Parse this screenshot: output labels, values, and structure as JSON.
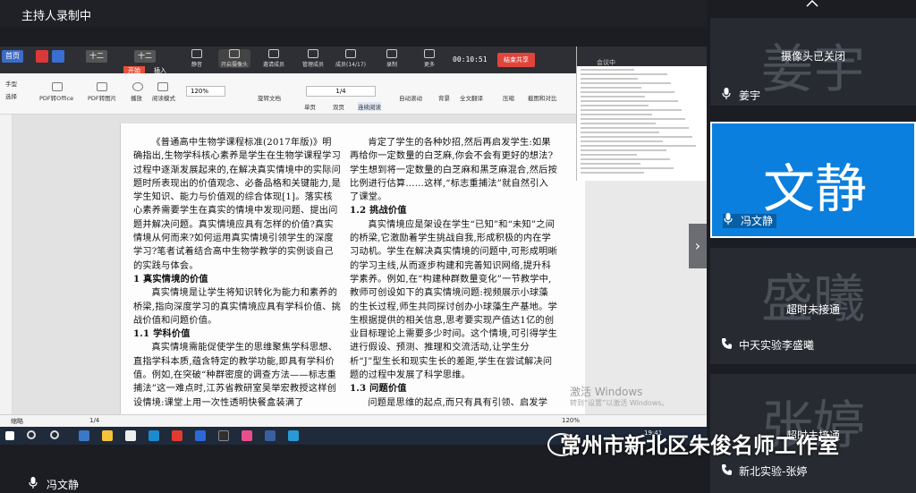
{
  "recording": {
    "label": "主持人录制中"
  },
  "share_toolbar": {
    "tabs": [
      "首页",
      "",
      "",
      "",
      "十二",
      "十二"
    ],
    "items": [
      "静音",
      "开启摄像头",
      "邀请成员",
      "管理成员",
      "成员(14/17)",
      "录制",
      "更多"
    ],
    "timer": "00:10:51",
    "end_label": "结束共享",
    "start_tab": "开始",
    "insert_tab": "插入"
  },
  "ribbon": {
    "items": [
      "手型",
      "选择",
      "PDF转Office",
      "PDF转图片",
      "播放",
      "阅读模式",
      "旋转文档",
      "单页",
      "双页",
      "连续阅读",
      "自动滚动",
      "背景",
      "全文翻译",
      "压缩",
      "截图和对比"
    ],
    "zoom": "120%",
    "page": "1/4"
  },
  "document": {
    "col1": [
      {
        "t": "《普通高中生物学课程标准(2017年版)》明确指出,生物学科核心素养是学生在生物学课程学习过程中逐渐发展起来的,在解决真实情境中的实际问题时所表现出的价值观念、必备品格和关键能力,是学生知识、能力与价值观的综合体现[1]。落实核心素养需要学生在真实的情境中发现问题、提出问题并解决问题。真实情境应具有怎样的价值?真实情境从何而来?如何运用真实情境引领学生的深度学习?笔者试着结合高中生物学教学的实例谈自己的实践与体会。",
        "h": false
      },
      {
        "t": "1 真实情境的价值",
        "h": true
      },
      {
        "t": "真实情境是让学生将知识转化为能力和素养的桥梁,指向深度学习的真实情境应具有学科价值、挑战价值和问题价值。",
        "h": false
      },
      {
        "t": "1.1 学科价值",
        "h": true
      },
      {
        "t": "真实情境需能促使学生的思维聚焦学科思想、直指学科本质,蕴含特定的教学功能,即具有学科价值。例如,在突破“种群密度的调查方法——标志重捕法”这一难点时,江苏省教研室吴举宏教授这样创设情境:课堂上用一次性透明快餐盒装满了",
        "h": false
      }
    ],
    "col2": [
      {
        "t": "肯定了学生的各种妙招,然后再启发学生:如果再给你一定数量的白芝麻,你会不会有更好的想法?学生想到将一定数量的白芝麻和黑芝麻混合,然后按比例进行估算……这样,“标志重捕法”就自然引入了课堂。",
        "h": false
      },
      {
        "t": "1.2 挑战价值",
        "h": true
      },
      {
        "t": "真实情境应是架设在学生“已知”和“未知”之间的桥梁,它激励着学生挑战自我,形成积极的内在学习动机。学生在解决真实情境的问题中,可形成明晰的学习主线,从而逐步构建和完善知识网络,提升科学素养。例如,在“构建种群数量变化”一节教学中,教师可创设如下的真实情境问题:视频展示小球藻的生长过程,师生共同探讨创办小球藻生产基地。学生根据提供的相关信息,思考要实现产值达1亿的创业目标理论上需要多少时间。这个情境,可引得学生进行假设、预测、推理和交流活动,让学生分析“J”型生长和现实生长的差距,学生在尝试解决问题的过程中发展了科学思维。",
        "h": false
      },
      {
        "t": "1.3 问题价值",
        "h": true
      },
      {
        "t": "问题是思维的起点,而只有具有引领、启发学",
        "h": false
      }
    ]
  },
  "status_bar": {
    "left": "缩略",
    "page": "1/4",
    "zoom": "120%"
  },
  "taskbar": {
    "time": "19:41"
  },
  "mini_meeting": {
    "title": "会议中"
  },
  "activate": {
    "line1": "激活 Windows",
    "line2": "转到“设置”以激活 Windows。"
  },
  "speaker": {
    "name": "冯文静"
  },
  "participants": [
    {
      "big": "姜宇",
      "status": "摄像头已关闭",
      "name": "姜宇",
      "active": false,
      "icon": "mic-icon"
    },
    {
      "big": "文静",
      "status": "",
      "name": "冯文静",
      "active": true,
      "icon": "mic-icon"
    },
    {
      "big": "盛曦",
      "status": "超时未接通",
      "name": "中天实验李盛曦",
      "active": false,
      "icon": "phone-icon"
    },
    {
      "big": "张婷",
      "status": "超时未接通",
      "name": "新北实验-张婷",
      "active": false,
      "icon": "phone-icon"
    }
  ],
  "watermark": {
    "text": "常州市新北区朱俊名师工作室"
  },
  "colors": {
    "active_tile": "#0b7fde",
    "end_share": "#e0443b",
    "panel_bg": "#1b1d22"
  }
}
